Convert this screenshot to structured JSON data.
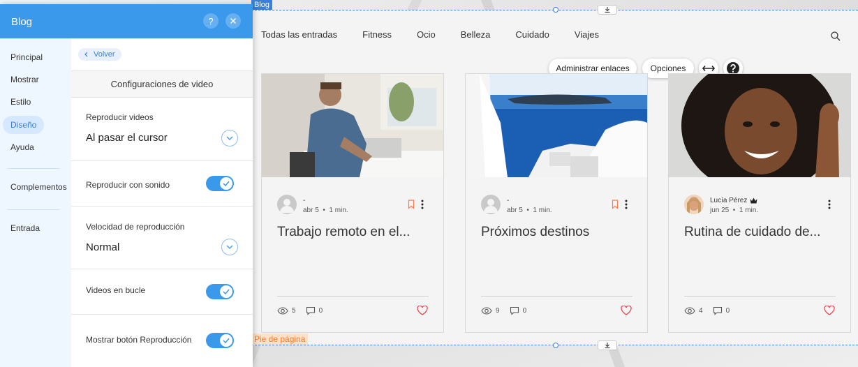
{
  "canvas": {
    "section_label": "Blog",
    "footer_label": "Pie de página"
  },
  "blog_nav": {
    "items": [
      "Todas las entradas",
      "Fitness",
      "Ocio",
      "Belleza",
      "Cuidado",
      "Viajes"
    ]
  },
  "toolbar": {
    "manage_links": "Administrar enlaces",
    "options": "Opciones"
  },
  "posts": [
    {
      "author": "-",
      "date": "abr 5",
      "read_time": "1 min.",
      "title": "Trabajo remoto en el...",
      "views": "5",
      "comments": "0",
      "bookmark": true,
      "crown": false
    },
    {
      "author": "-",
      "date": "abr 5",
      "read_time": "1 min.",
      "title": "Próximos destinos",
      "views": "9",
      "comments": "0",
      "bookmark": true,
      "crown": false
    },
    {
      "author": "Lucía Pérez",
      "date": "jun 25",
      "read_time": "1 min.",
      "title": "Rutina de cuidado de...",
      "views": "4",
      "comments": "0",
      "bookmark": false,
      "crown": true
    }
  ],
  "panel": {
    "title": "Blog",
    "help_label": "?",
    "nav": [
      "Principal",
      "Mostrar",
      "Estilo",
      "Diseño",
      "Ayuda",
      "Complementos",
      "Entrada"
    ],
    "active_nav": "Diseño",
    "back_label": "Volver",
    "section_title": "Configuraciones de video",
    "settings": {
      "play_videos_label": "Reproducir videos",
      "play_videos_value": "Al pasar el cursor",
      "sound_label": "Reproducir con sonido",
      "speed_label": "Velocidad de reproducción",
      "speed_value": "Normal",
      "loop_label": "Videos en bucle",
      "show_play_label": "Mostrar botón Reproducción"
    },
    "toggles": {
      "sound": true,
      "loop": true,
      "show_play": true
    }
  },
  "colors": {
    "accent": "#3b99ec",
    "selection": "#3b7fd9",
    "bookmark": "#ff7a4d",
    "heart": "#e8474d",
    "footer_tag": "#ff7a29"
  },
  "icons": {
    "search": "search-icon",
    "bookmark": "bookmark-icon",
    "more": "more-vertical-icon",
    "eye": "eye-icon",
    "comment": "comment-icon",
    "heart": "heart-icon",
    "crown": "crown-icon",
    "close": "close-icon",
    "chevron_down": "chevron-down-icon",
    "check": "check-icon",
    "stretch": "stretch-horizontal-icon",
    "help": "help-icon"
  }
}
